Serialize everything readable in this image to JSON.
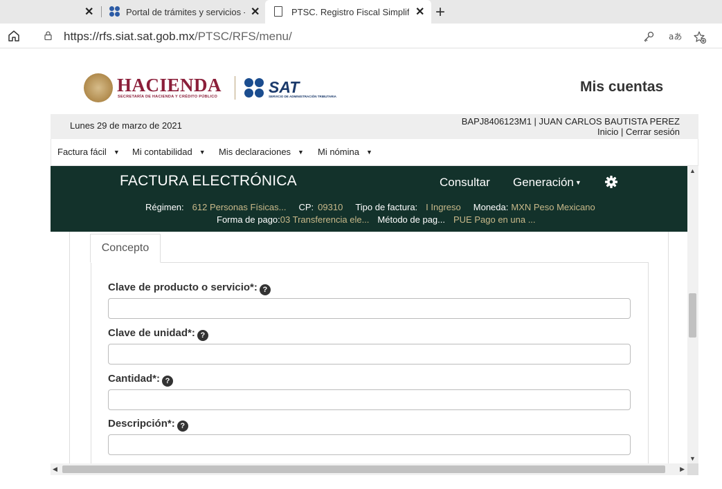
{
  "browser": {
    "tabs": [
      {
        "title": ""
      },
      {
        "title": "Portal de trámites y servicios - SAT"
      },
      {
        "title": "PTSC. Registro Fiscal Simplificado"
      }
    ],
    "close_glyph": "✕",
    "new_tab_glyph": "+",
    "url_host": "https://rfs.siat.sat.gob.mx",
    "url_path": "/PTSC/RFS/menu/",
    "icons": [
      "home-icon",
      "lock-icon",
      "key-icon",
      "read-aloud-icon",
      "favorites-icon"
    ]
  },
  "header": {
    "hacienda_title": "HACIENDA",
    "hacienda_subtitle": "SECRETARÍA DE HACIENDA Y CRÉDITO PÚBLICO",
    "sat_title": "SAT",
    "sat_subtitle": "SERVICIO DE ADMINISTRACIÓN TRIBUTARIA",
    "mis_cuentas": "Mis cuentas"
  },
  "infobar": {
    "date": "Lunes 29 de marzo de 2021",
    "user": "BAPJ8406123M1 | JUAN CARLOS BAUTISTA PEREZ",
    "inicio": "Inicio",
    "separator": " | ",
    "cerrar_sesion": "Cerrar sesión"
  },
  "menu": {
    "items": [
      {
        "label": "Factura fácil"
      },
      {
        "label": "Mi contabilidad"
      },
      {
        "label": "Mis declaraciones"
      },
      {
        "label": "Mi nómina"
      }
    ],
    "caret": "▼"
  },
  "app": {
    "title": "FACTURA ELECTRÓNICA",
    "nav_consultar": "Consultar",
    "nav_generacion": "Generación",
    "nav_caret": "▼",
    "meta": {
      "regimen_label": "Régimen:",
      "regimen_value": "612 Personas Físicas...",
      "cp_label": "CP:",
      "cp_value": "09310",
      "tipo_label": "Tipo de factura:",
      "tipo_value": "I Ingreso",
      "moneda_label": "Moneda:",
      "moneda_value": "MXN Peso Mexicano",
      "forma_label": "Forma de pago:",
      "forma_value": "03 Transferencia ele...",
      "metodo_label": "Método de pag...",
      "metodo_value": "PUE Pago en una ..."
    },
    "active_tab": "Concepto",
    "help_glyph": "?",
    "fields": [
      {
        "label": "Clave de producto o servicio*:",
        "value": ""
      },
      {
        "label": "Clave de unidad*:",
        "value": ""
      },
      {
        "label": "Cantidad*:",
        "value": ""
      },
      {
        "label": "Descripción*:",
        "value": ""
      }
    ]
  },
  "scroll": {
    "up": "▲",
    "down": "▼",
    "left": "◀",
    "right": "▶"
  },
  "colors": {
    "app_header": "#13322b",
    "meta_value": "#c9b98a",
    "hacienda": "#8b1f3a",
    "sat_blue": "#1b4d8f"
  }
}
